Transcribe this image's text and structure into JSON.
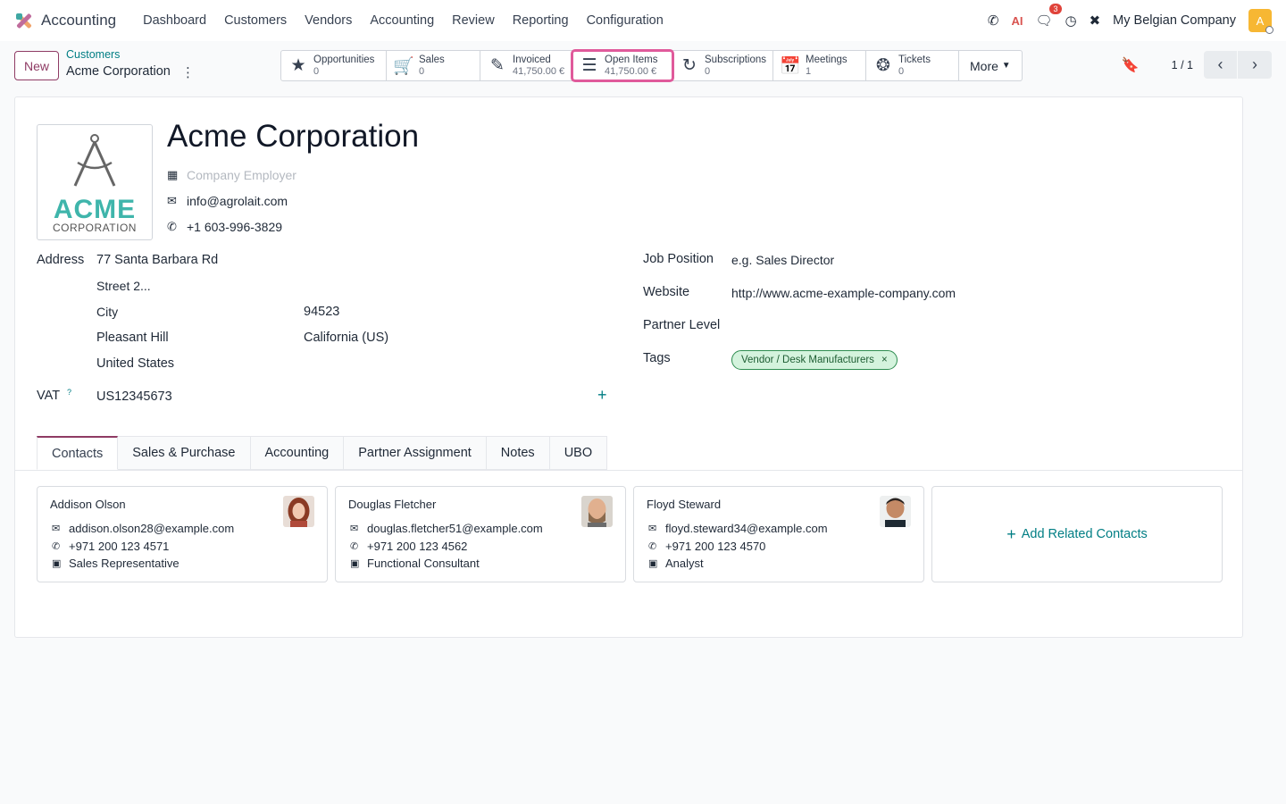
{
  "navbar": {
    "app_name": "Accounting",
    "menu": [
      "Dashboard",
      "Customers",
      "Vendors",
      "Accounting",
      "Review",
      "Reporting",
      "Configuration"
    ],
    "chat_badge": "3",
    "company": "My Belgian Company",
    "avatar_letter": "A"
  },
  "control": {
    "new_label": "New",
    "breadcrumb_parent": "Customers",
    "breadcrumb_current": "Acme Corporation",
    "smart_buttons": [
      {
        "icon": "star-icon",
        "label": "Opportunities",
        "value": "0"
      },
      {
        "icon": "cart-icon",
        "label": "Sales",
        "value": "0"
      },
      {
        "icon": "edit-icon",
        "label": "Invoiced",
        "value": "41,750.00 €"
      },
      {
        "icon": "list-icon",
        "label": "Open Items",
        "value": "41,750.00 €"
      },
      {
        "icon": "refresh-icon",
        "label": "Subscriptions",
        "value": "0"
      },
      {
        "icon": "calendar-icon",
        "label": "Meetings",
        "value": "1"
      },
      {
        "icon": "lifebuoy-icon",
        "label": "Tickets",
        "value": "0"
      }
    ],
    "more_label": "More",
    "pager": "1 / 1"
  },
  "form": {
    "logo_word": "ACME",
    "logo_sub": "CORPORATION",
    "name": "Acme Corporation",
    "company_placeholder": "Company Employer",
    "email": "info@agrolait.com",
    "phone": "+1 603-996-3829",
    "address_label": "Address",
    "street": "77 Santa Barbara Rd",
    "street2_placeholder": "Street 2...",
    "city_placeholder": "City",
    "zip": "94523",
    "city": "Pleasant Hill",
    "state": "California (US)",
    "country": "United States",
    "vat_label": "VAT",
    "vat_help": "?",
    "vat": "US12345673",
    "job_position_label": "Job Position",
    "job_position_placeholder": "e.g. Sales Director",
    "website_label": "Website",
    "website": "http://www.acme-example-company.com",
    "partner_level_label": "Partner Level",
    "tags_label": "Tags",
    "tag": "Vendor / Desk Manufacturers"
  },
  "tabs": [
    "Contacts",
    "Sales & Purchase",
    "Accounting",
    "Partner Assignment",
    "Notes",
    "UBO"
  ],
  "contacts": [
    {
      "name": "Addison Olson",
      "email": "addison.olson28@example.com",
      "phone": "+971 200 123 4571",
      "role": "Sales Representative"
    },
    {
      "name": "Douglas Fletcher",
      "email": "douglas.fletcher51@example.com",
      "phone": "+971 200 123 4562",
      "role": "Functional Consultant"
    },
    {
      "name": "Floyd Steward",
      "email": "floyd.steward34@example.com",
      "phone": "+971 200 123 4570",
      "role": "Analyst"
    }
  ],
  "add_contacts_label": "Add Related Contacts",
  "colors": {
    "brand": "#8f3b64",
    "accent": "#017e84",
    "highlight": "#e05a9b"
  }
}
